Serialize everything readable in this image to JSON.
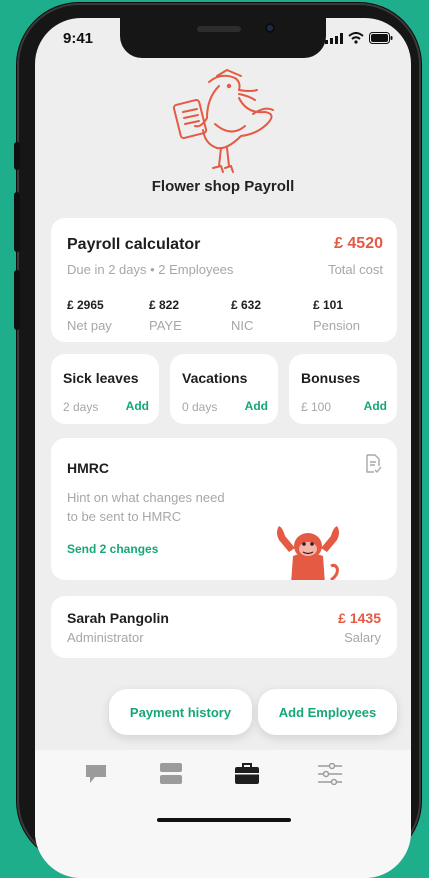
{
  "status_bar": {
    "time": "9:41"
  },
  "header": {
    "title": "Flower shop Payroll"
  },
  "payroll": {
    "title": "Payroll calculator",
    "subtitle": "Due in 2 days • 2 Employees",
    "total_value": "£ 4520",
    "total_label": "Total cost",
    "items": [
      {
        "value": "£ 2965",
        "label": "Net pay"
      },
      {
        "value": "£ 822",
        "label": "PAYE"
      },
      {
        "value": "£ 632",
        "label": "NIC"
      },
      {
        "value": "£ 101",
        "label": "Pension"
      }
    ]
  },
  "mini_cards": [
    {
      "title": "Sick leaves",
      "value": "2 days",
      "action": "Add"
    },
    {
      "title": "Vacations",
      "value": "0 days",
      "action": "Add"
    },
    {
      "title": "Bonuses",
      "value": "£ 100",
      "action": "Add"
    }
  ],
  "hmrc": {
    "title": "HMRC",
    "hint_line1": "Hint on what changes need",
    "hint_line2": "to be sent to HMRC",
    "action": "Send 2 changes"
  },
  "employee": {
    "name": "Sarah Pangolin",
    "role": "Administrator",
    "salary_value": "£ 1435",
    "salary_label": "Salary"
  },
  "actions": {
    "payment_history": "Payment history",
    "add_employees": "Add Employees"
  },
  "tabbar": {
    "icons": [
      "chat-icon",
      "layers-icon",
      "briefcase-icon",
      "sliders-icon"
    ],
    "active_index": 2
  },
  "colors": {
    "accent_green": "#17a777",
    "accent_red": "#e45a43",
    "background": "#1fae8c"
  }
}
